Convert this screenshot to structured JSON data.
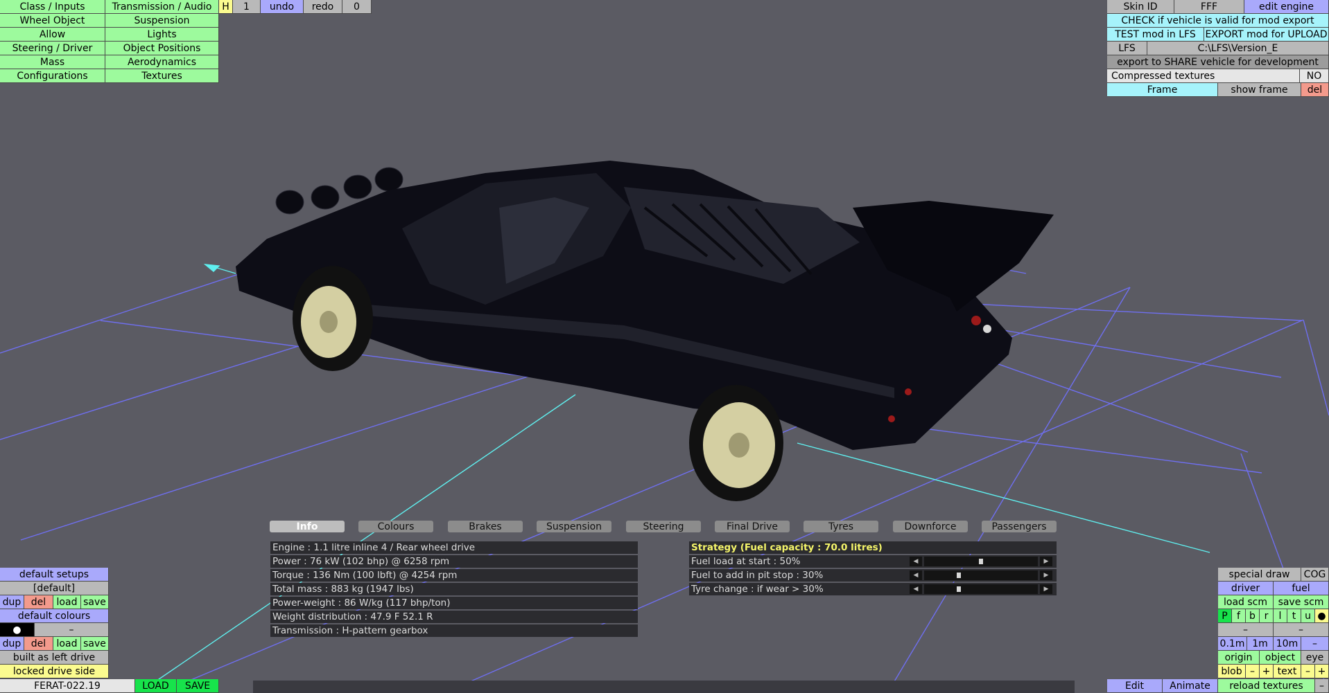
{
  "left_menu": [
    [
      "Class / Inputs",
      "Transmission / Audio"
    ],
    [
      "Wheel Object",
      "Suspension"
    ],
    [
      "Allow",
      "Lights"
    ],
    [
      "Steering / Driver",
      "Object Positions"
    ],
    [
      "Mass",
      "Aerodynamics"
    ],
    [
      "Configurations",
      "Textures"
    ]
  ],
  "top_toolbar": {
    "h": "H",
    "one": "1",
    "undo": "undo",
    "redo": "redo",
    "zero": "0"
  },
  "right_top": {
    "skin_id_label": "Skin ID",
    "skin_id_value": "FFF",
    "edit_engine": "edit engine",
    "check_valid": "CHECK if vehicle is valid for mod export",
    "test_mod": "TEST mod in LFS",
    "export_mod": "EXPORT mod for UPLOAD",
    "lfs_label": "LFS",
    "lfs_path": "C:\\LFS\\Version_E",
    "export_share": "export to SHARE vehicle for development",
    "compressed_label": "Compressed textures",
    "compressed_value": "NO",
    "frame": "Frame",
    "show_frame": "show frame",
    "del": "del"
  },
  "tabs": [
    "Info",
    "Colours",
    "Brakes",
    "Suspension",
    "Steering",
    "Final Drive",
    "Tyres",
    "Downforce",
    "Passengers"
  ],
  "active_tab": "Info",
  "info_lines": [
    "Engine : 1.1 litre inline 4 / Rear wheel drive",
    "Power : 76 kW (102 bhp) @ 6258 rpm",
    "Torque : 136 Nm (100 lbft) @ 4254 rpm",
    "Total mass : 883 kg (1947 lbs)",
    "Power-weight : 86 W/kg (117 bhp/ton)",
    "Weight distribution : 47.9 F  52.1 R",
    "Transmission : H-pattern gearbox"
  ],
  "strategy": {
    "header": "Strategy (Fuel capacity : 70.0 litres)",
    "rows": [
      {
        "label": "Fuel load at start : 50%",
        "value": 0.5
      },
      {
        "label": "Fuel to add in pit stop : 30%",
        "value": 0.3
      },
      {
        "label": "Tyre change : if wear > 30%",
        "value": 0.3
      }
    ]
  },
  "bottom_left": {
    "default_setups": "default setups",
    "default_bracket": "[default]",
    "dup": "dup",
    "del": "del",
    "load": "load",
    "save": "save",
    "default_colours": "default colours",
    "colour_dot": "●",
    "dash": "–",
    "built_left": "built as left drive",
    "locked_side": "locked drive side",
    "vehicle_name": "FERAT-022.19",
    "load_btn": "LOAD",
    "save_btn": "SAVE"
  },
  "bottom_right": {
    "special_draw": "special draw",
    "cog": "COG",
    "driver": "driver",
    "fuel": "fuel",
    "load_scm": "load scm",
    "save_scm": "save scm",
    "letters": [
      "P",
      "f",
      "b",
      "r",
      "l",
      "t",
      "u",
      "●"
    ],
    "dash": "–",
    "scale": [
      "0.1m",
      "1m",
      "10m",
      "–"
    ],
    "origin": "origin",
    "object": "object",
    "eye": "eye",
    "blob": "blob",
    "minus": "–",
    "plus": "+",
    "text": "text",
    "edit": "Edit",
    "animate": "Animate",
    "reload_textures": "reload textures"
  },
  "colors": {
    "background": "#5b5b63",
    "grid_blue": "#6f6ff0",
    "grid_cyan": "#5ff0f0",
    "menu_green": "#9dfa9d",
    "cyan_btn": "#a6f3fb",
    "purple_btn": "#a9a9fb"
  }
}
